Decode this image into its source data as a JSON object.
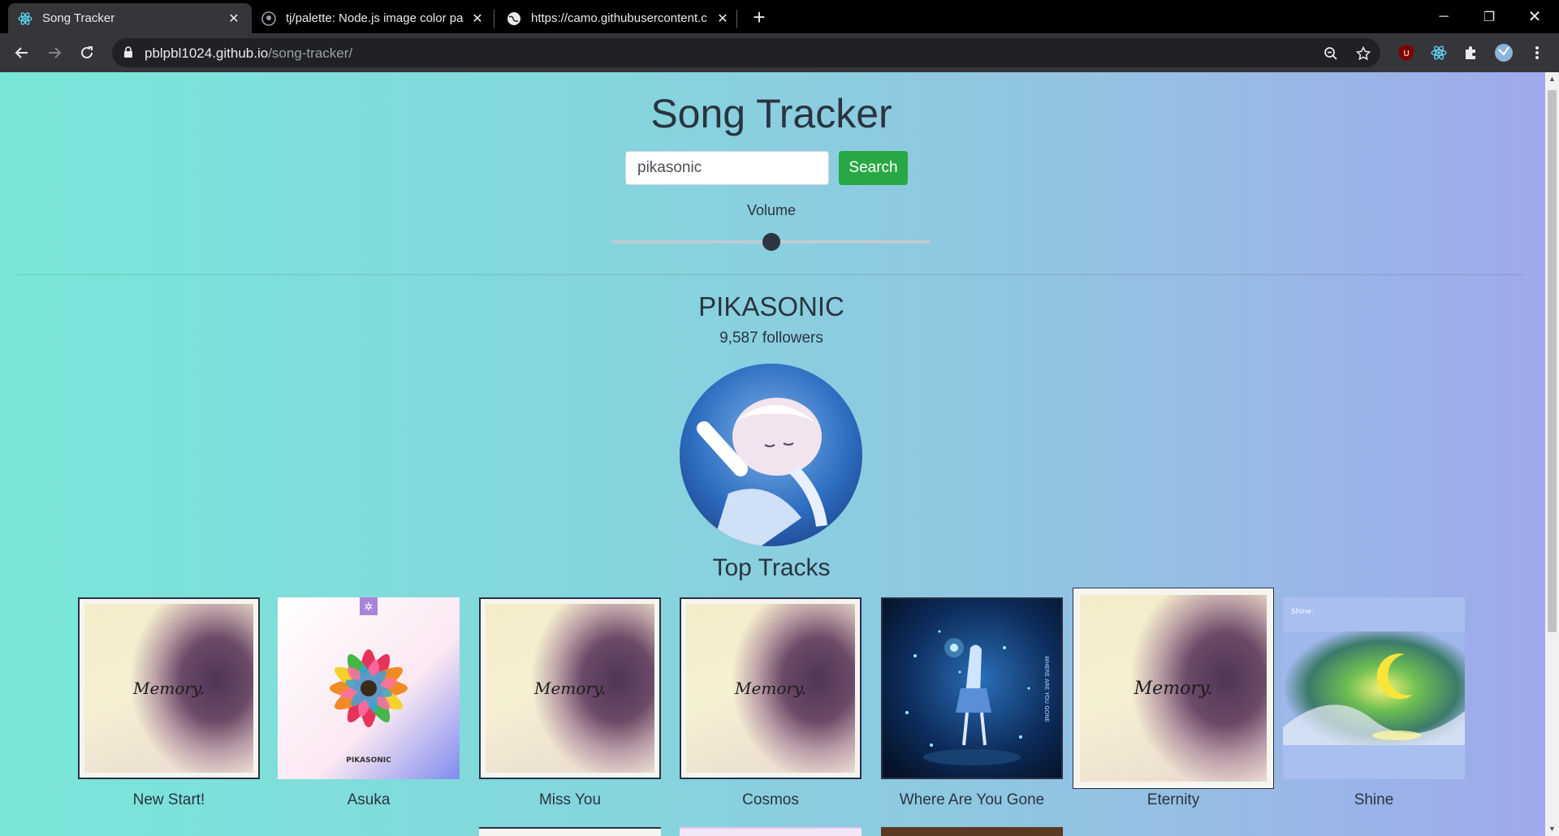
{
  "browser": {
    "tabs": [
      {
        "title": "Song Tracker",
        "active": true
      },
      {
        "title": "tj/palette: Node.js image color pa",
        "active": false
      },
      {
        "title": "https://camo.githubusercontent.c",
        "active": false
      }
    ],
    "url": {
      "host": "pblpbl1024.github.io",
      "path": "/song-tracker/"
    }
  },
  "app": {
    "title": "Song Tracker",
    "search": {
      "value": "pikasonic",
      "button_label": "Search"
    },
    "volume": {
      "label": "Volume",
      "level": 0.5
    }
  },
  "artist": {
    "name": "PIKASONIC",
    "followers": "9,587 followers"
  },
  "top_tracks": {
    "heading": "Top Tracks",
    "tracks": [
      {
        "name": "New Start!",
        "cover_text": "Memory."
      },
      {
        "name": "Asuka",
        "cover_text": "PIKASONIC"
      },
      {
        "name": "Miss You",
        "cover_text": "Memory."
      },
      {
        "name": "Cosmos",
        "cover_text": "Memory."
      },
      {
        "name": "Where Are You Gone",
        "cover_text": "WHERE ARE YOU GONE"
      },
      {
        "name": "Eternity",
        "cover_text": "Memory."
      },
      {
        "name": "Shine",
        "cover_text": "Shine."
      }
    ]
  },
  "colors": {
    "search_button": "#28a745",
    "gradient_left": "#79e7d7",
    "gradient_right": "#a0a8ec"
  }
}
